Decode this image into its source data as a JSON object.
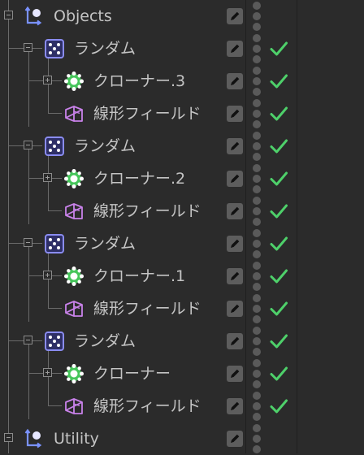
{
  "colors": {
    "background": "#2b2b2b",
    "text": "#c4c4c4",
    "tree_line": "#6a6a6a",
    "check": "#4ed06a",
    "cloner_green": "#45c55a",
    "random_blue": "#8a8cf0",
    "field_violet": "#c982ea",
    "edit_box": "#5d5d5d",
    "dot": "#5a5a5a"
  },
  "tree": [
    {
      "label": "Objects",
      "icon": "null-object-icon",
      "depth": 0,
      "expander": "minus",
      "check": false
    },
    {
      "label": "ランダム",
      "icon": "random-effector-icon",
      "depth": 1,
      "expander": "minus",
      "check": true
    },
    {
      "label": "クローナー.3",
      "icon": "cloner-icon",
      "depth": 2,
      "expander": "plus",
      "check": true
    },
    {
      "label": "線形フィールド",
      "icon": "linear-field-icon",
      "depth": 2,
      "expander": "none",
      "check": true
    },
    {
      "label": "ランダム",
      "icon": "random-effector-icon",
      "depth": 1,
      "expander": "minus",
      "check": true
    },
    {
      "label": "クローナー.2",
      "icon": "cloner-icon",
      "depth": 2,
      "expander": "plus",
      "check": true
    },
    {
      "label": "線形フィールド",
      "icon": "linear-field-icon",
      "depth": 2,
      "expander": "none",
      "check": true
    },
    {
      "label": "ランダム",
      "icon": "random-effector-icon",
      "depth": 1,
      "expander": "minus",
      "check": true
    },
    {
      "label": "クローナー.1",
      "icon": "cloner-icon",
      "depth": 2,
      "expander": "plus",
      "check": true
    },
    {
      "label": "線形フィールド",
      "icon": "linear-field-icon",
      "depth": 2,
      "expander": "none",
      "check": true
    },
    {
      "label": "ランダム",
      "icon": "random-effector-icon",
      "depth": 1,
      "expander": "minus",
      "check": true
    },
    {
      "label": "クローナー",
      "icon": "cloner-icon",
      "depth": 2,
      "expander": "plus",
      "check": true
    },
    {
      "label": "線形フィールド",
      "icon": "linear-field-icon",
      "depth": 2,
      "expander": "none",
      "check": true
    },
    {
      "label": "Utility",
      "icon": "null-object-icon",
      "depth": 0,
      "expander": "minus",
      "check": false
    }
  ]
}
